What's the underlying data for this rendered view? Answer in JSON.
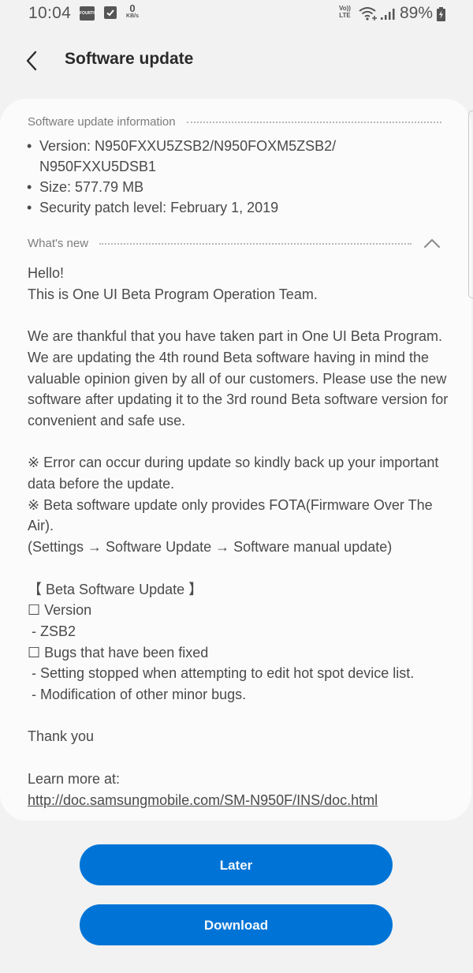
{
  "status_bar": {
    "time": "10:04",
    "fourth_icon_label": "FOURTH",
    "net_speed_value": "0",
    "net_speed_unit": "KB/s",
    "volte_line1": "Vo))",
    "volte_line2": "LTE",
    "battery_percent": "89%",
    "icons": [
      "fourth-app-icon",
      "checkbox-notification-icon",
      "volte-icon",
      "wifi-icon",
      "signal-icon",
      "battery-charging-icon"
    ]
  },
  "header": {
    "title": "Software update",
    "back_icon": "chevron-left-icon"
  },
  "info_section": {
    "label": "Software update information",
    "items": [
      {
        "bullet": "•",
        "text": "Version: N950FXXU5ZSB2/N950FOXM5ZSB2/ N950FXXU5DSB1"
      },
      {
        "bullet": "•",
        "text": "Size: 577.79 MB"
      },
      {
        "bullet": "•",
        "text": "Security patch level: February 1, 2019"
      }
    ]
  },
  "whats_new": {
    "label": "What's new",
    "toggle_icon": "chevron-up-icon",
    "lines": [
      "Hello!",
      "This is One UI Beta Program Operation Team.",
      "",
      "We are thankful that you have taken part in One UI Beta Program. We are updating the 4th round Beta software having in mind the valuable opinion given by all of our customers. Please use the new software after updating it to the 3rd round Beta software version for convenient and safe use.",
      "",
      "※ Error can occur during update so kindly back up your important data before the update.",
      "※ Beta software update only provides FOTA(Firmware Over The Air).",
      "(Settings → Software Update → Software manual update)",
      "",
      "【 Beta Software Update 】",
      "☐ Version",
      " - ZSB2",
      "☐ Bugs that have been fixed",
      " - Setting stopped when attempting to edit hot spot device list.",
      " - Modification of other minor bugs.",
      "",
      "Thank you",
      "",
      "Learn more at:"
    ],
    "link": "http://doc.samsungmobile.com/SM-N950F/INS/doc.html"
  },
  "buttons": {
    "later": "Later",
    "download": "Download"
  },
  "colors": {
    "accent": "#0074d6",
    "background": "#f2f2f2",
    "card": "#fbfbfb"
  }
}
